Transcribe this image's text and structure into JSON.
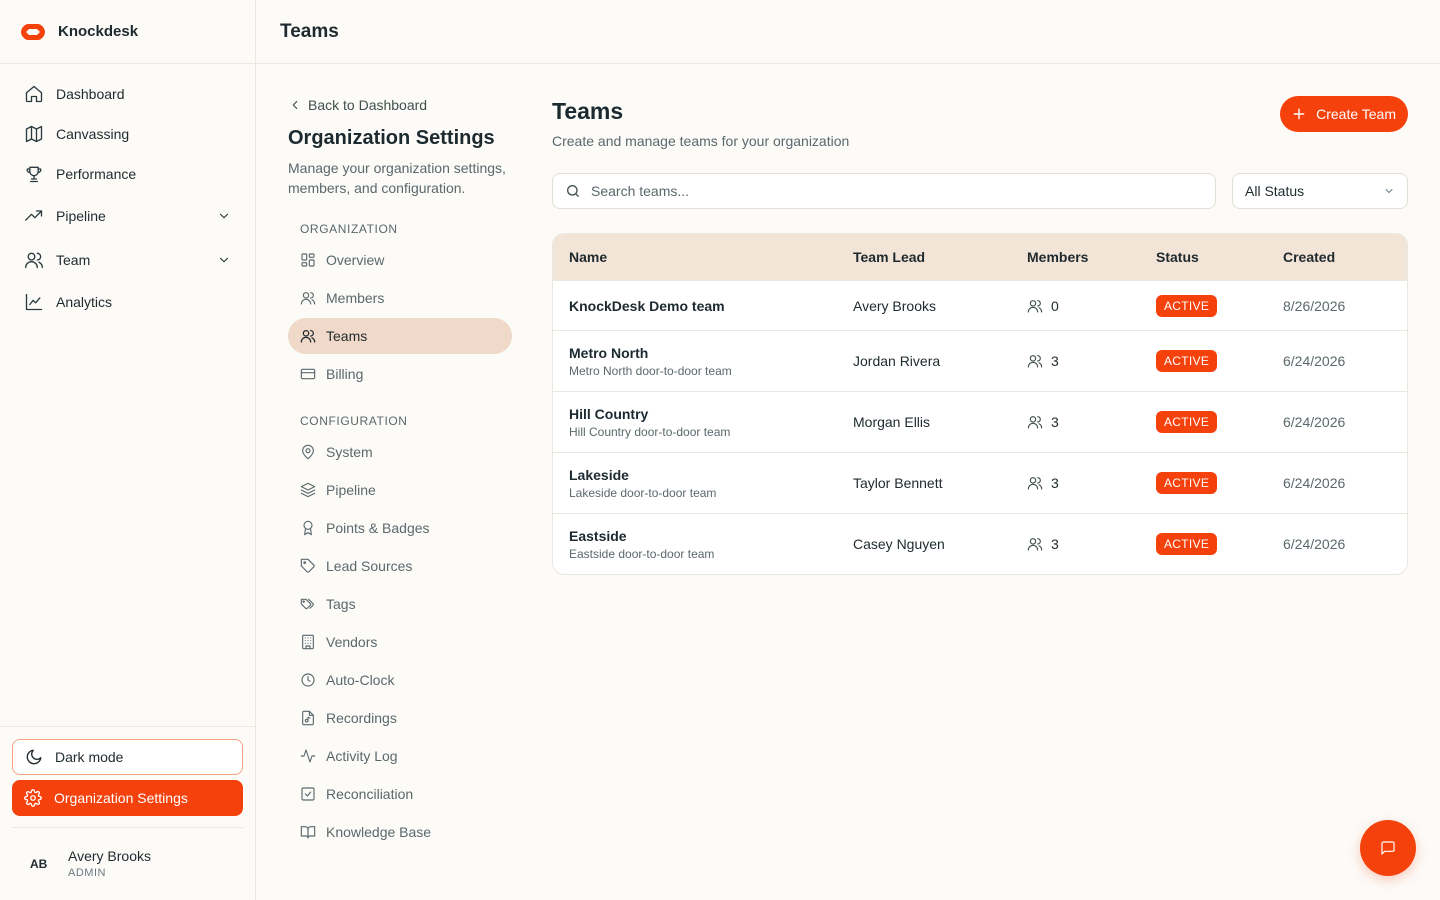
{
  "app": {
    "name": "Knockdesk"
  },
  "sidebar": {
    "items": [
      {
        "label": "Dashboard",
        "icon": "home-icon"
      },
      {
        "label": "Canvassing",
        "icon": "map-icon"
      },
      {
        "label": "Performance",
        "icon": "trophy-icon"
      },
      {
        "label": "Pipeline",
        "icon": "trending-up-icon",
        "expandable": true
      },
      {
        "label": "Team",
        "icon": "users-icon",
        "expandable": true
      },
      {
        "label": "Analytics",
        "icon": "line-chart-icon"
      }
    ],
    "dark_mode_label": "Dark mode",
    "org_settings_label": "Organization Settings",
    "user": {
      "initials": "AB",
      "name": "Avery Brooks",
      "role": "ADMIN"
    }
  },
  "header": {
    "title": "Teams"
  },
  "settings_nav": {
    "back_label": "Back to Dashboard",
    "title": "Organization Settings",
    "description": "Manage your organization settings, members, and configuration.",
    "sections": [
      {
        "label": "ORGANIZATION",
        "items": [
          {
            "label": "Overview",
            "icon": "grid-icon"
          },
          {
            "label": "Members",
            "icon": "users-icon"
          },
          {
            "label": "Teams",
            "icon": "users-icon",
            "active": true
          },
          {
            "label": "Billing",
            "icon": "credit-card-icon"
          }
        ]
      },
      {
        "label": "CONFIGURATION",
        "items": [
          {
            "label": "System",
            "icon": "map-pin-icon"
          },
          {
            "label": "Pipeline",
            "icon": "layers-icon"
          },
          {
            "label": "Points & Badges",
            "icon": "award-icon"
          },
          {
            "label": "Lead Sources",
            "icon": "tag-icon"
          },
          {
            "label": "Tags",
            "icon": "tags-icon"
          },
          {
            "label": "Vendors",
            "icon": "building-icon"
          },
          {
            "label": "Auto-Clock",
            "icon": "clock-icon"
          },
          {
            "label": "Recordings",
            "icon": "file-audio-icon"
          },
          {
            "label": "Activity Log",
            "icon": "activity-icon"
          },
          {
            "label": "Reconciliation",
            "icon": "check-square-icon"
          },
          {
            "label": "Knowledge Base",
            "icon": "book-icon"
          }
        ]
      }
    ]
  },
  "main": {
    "title": "Teams",
    "subtitle": "Create and manage teams for your organization",
    "create_button": "Create Team",
    "search_placeholder": "Search teams...",
    "status_filter": "All Status",
    "table": {
      "columns": [
        "Name",
        "Team Lead",
        "Members",
        "Status",
        "Created"
      ],
      "rows": [
        {
          "name": "KnockDesk Demo team",
          "description": "",
          "lead": "Avery Brooks",
          "members": "0",
          "status": "ACTIVE",
          "created": "8/26/2026"
        },
        {
          "name": "Metro North",
          "description": "Metro North door-to-door team",
          "lead": "Jordan Rivera",
          "members": "3",
          "status": "ACTIVE",
          "created": "6/24/2026"
        },
        {
          "name": "Hill Country",
          "description": "Hill Country door-to-door team",
          "lead": "Morgan Ellis",
          "members": "3",
          "status": "ACTIVE",
          "created": "6/24/2026"
        },
        {
          "name": "Lakeside",
          "description": "Lakeside door-to-door team",
          "lead": "Taylor Bennett",
          "members": "3",
          "status": "ACTIVE",
          "created": "6/24/2026"
        },
        {
          "name": "Eastside",
          "description": "Eastside door-to-door team",
          "lead": "Casey Nguyen",
          "members": "3",
          "status": "ACTIVE",
          "created": "6/24/2026"
        }
      ]
    }
  },
  "colors": {
    "accent": "#f5410c",
    "active_nav_bg": "#f0d9c8",
    "table_header_bg": "#f3e4d8",
    "background": "#fcfbf8"
  }
}
